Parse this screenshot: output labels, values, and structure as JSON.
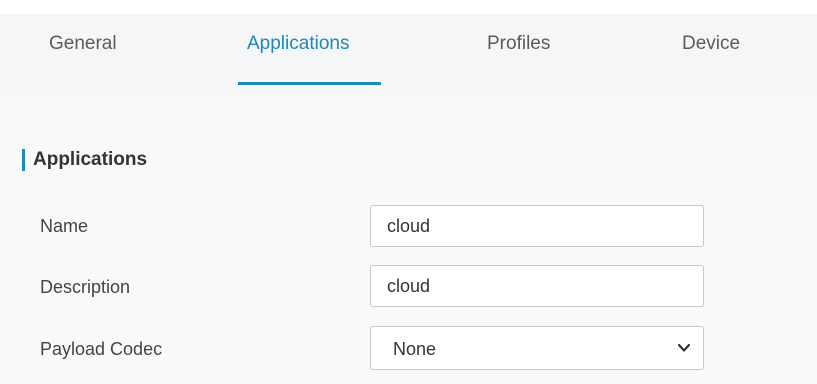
{
  "tabs": {
    "general": "General",
    "applications": "Applications",
    "profiles": "Profiles",
    "device": "Device",
    "active": "applications"
  },
  "section": {
    "title": "Applications"
  },
  "form": {
    "name_label": "Name",
    "name_value": "cloud",
    "description_label": "Description",
    "description_value": "cloud",
    "payload_codec_label": "Payload Codec",
    "payload_codec_value": "None"
  },
  "colors": {
    "accent": "#1e88b8",
    "tab_text": "#5b5b5b",
    "background": "#f4f6f7"
  },
  "icons": {
    "select_arrow": "chevron-down-icon"
  }
}
